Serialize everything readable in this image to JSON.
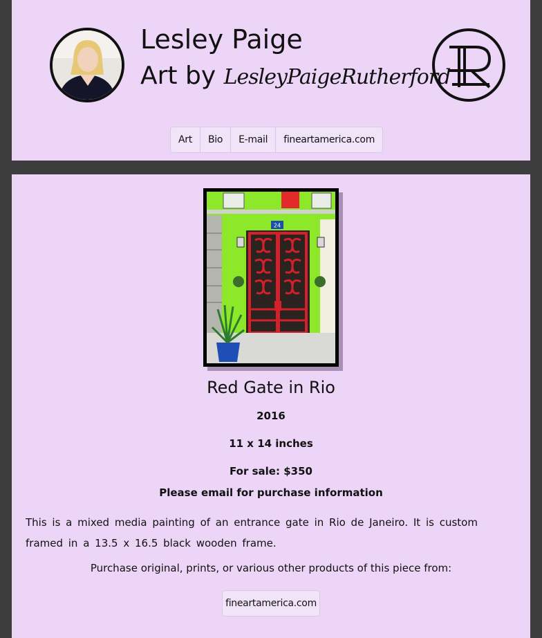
{
  "header": {
    "title": "Lesley Paige",
    "subtitle_prefix": "Art by",
    "subtitle_signature": "LesleyPaigeRutherford",
    "logo_icon": "pr-monogram-icon",
    "avatar_icon": "artist-avatar"
  },
  "nav": {
    "items": [
      {
        "label": "Art"
      },
      {
        "label": "Bio"
      },
      {
        "label": "E-mail"
      },
      {
        "label": "fineartamerica.com"
      }
    ]
  },
  "artwork": {
    "house_number": "24",
    "title": "Red Gate in Rio",
    "year": "2016",
    "dimensions": "11 x 14 inches",
    "sale": "For sale: $350",
    "purchase_note": "Please email for purchase information",
    "description": "This is a mixed media painting of an entrance gate in Rio de Janeiro. It is custom framed in a 13.5 x 16.5 black wooden frame.",
    "purchase_text": "Purchase original, prints, or various other products of this piece from:",
    "purchase_link": "fineartamerica.com"
  },
  "colors": {
    "background": "#3d3d3d",
    "panel": "#ecd5f7",
    "gate_red": "#d4202a",
    "wall_green": "#8ee82a"
  }
}
